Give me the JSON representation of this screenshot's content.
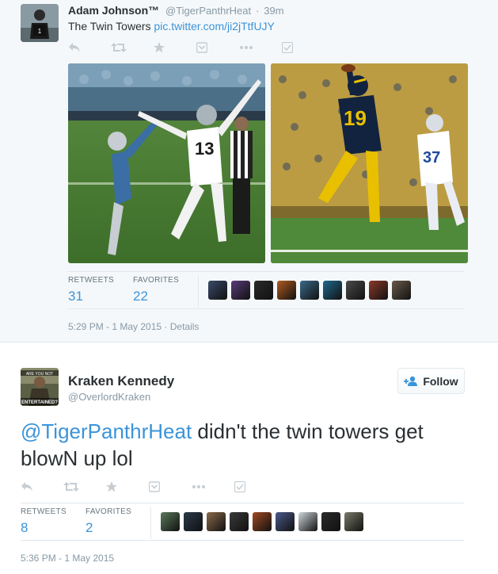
{
  "tweet1": {
    "fullname": "Adam Johnson™",
    "handle": "@TigerPanthrHeat",
    "time": "39m",
    "text": "The Twin Towers",
    "link": "pic.twitter.com/ji2jTtfUJY",
    "retweets_label": "RETWEETS",
    "retweets": "31",
    "favorites_label": "FAVORITES",
    "favorites": "22",
    "favoriter_count": 9,
    "timestamp": "5:29 PM - 1 May 2015",
    "details": "Details"
  },
  "tweet2": {
    "fullname": "Kraken Kennedy",
    "handle": "@OverlordKraken",
    "follow_label": "Follow",
    "mention": "@TigerPanthrHeat",
    "text": " didn't the twin towers get blowN up lol",
    "retweets_label": "RETWEETS",
    "retweets": "8",
    "favorites_label": "FAVORITES",
    "favorites": "2",
    "favoriter_count": 9,
    "timestamp": "5:36 PM - 1 May 2015"
  },
  "avatar_badge_lines": [
    "ARE YOU NOT",
    "ENTERTAINED?"
  ],
  "colors": {
    "link": "#3b94d9",
    "text": "#292f33",
    "muted": "#8899a6",
    "focused_bg": "#f5f8fa",
    "border": "#e1e8ed"
  },
  "icons": [
    "reply-icon",
    "retweet-icon",
    "favorite-icon",
    "pocket-icon",
    "more-icon",
    "check-icon",
    "follow-user-icon"
  ]
}
